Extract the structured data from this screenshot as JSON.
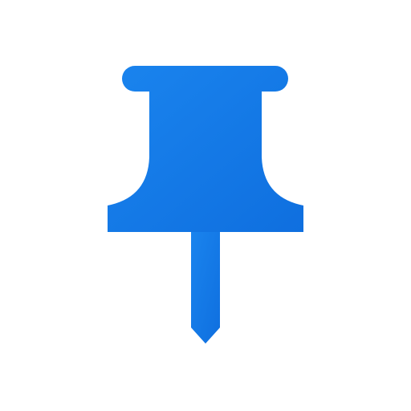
{
  "icon": {
    "name": "pushpin-icon",
    "colors": {
      "background": "#ffffff",
      "fill_light": "#1a84ee",
      "fill_dark": "#0f6fdf"
    }
  }
}
